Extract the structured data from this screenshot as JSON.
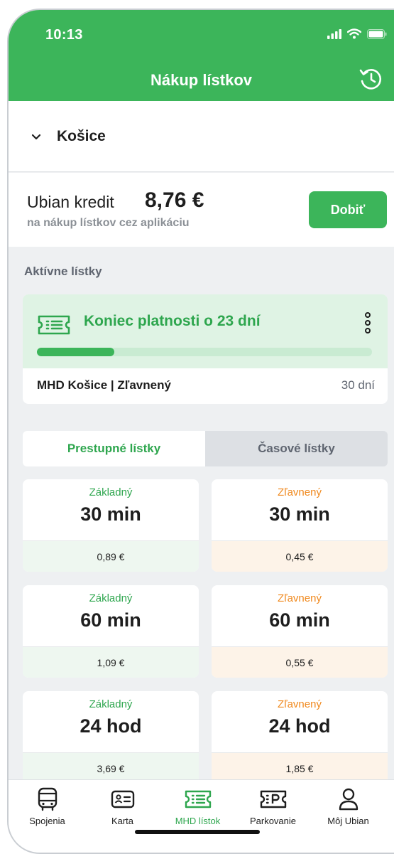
{
  "status": {
    "time": "10:13"
  },
  "header": {
    "title": "Nákup lístkov"
  },
  "city": {
    "name": "Košice"
  },
  "credit": {
    "label": "Ubian kredit",
    "amount": "8,76 €",
    "subtitle": "na nákup lístkov cez aplikáciu",
    "topup_label": "Dobiť"
  },
  "active": {
    "heading": "Aktívne lístky",
    "title": "Koniec platnosti o 23 dní",
    "progress_fraction": 0.23,
    "name": "MHD Košice | Zľavnený",
    "duration": "30 dní"
  },
  "tabs": [
    {
      "label": "Prestupné lístky",
      "selected": true
    },
    {
      "label": "Časové lístky",
      "selected": false
    }
  ],
  "tickets": [
    {
      "type": "Základný",
      "duration": "30 min",
      "price": "0,89 €"
    },
    {
      "type": "Zľavnený",
      "duration": "30 min",
      "price": "0,45 €"
    },
    {
      "type": "Základný",
      "duration": "60 min",
      "price": "1,09 €"
    },
    {
      "type": "Zľavnený",
      "duration": "60 min",
      "price": "0,55 €"
    },
    {
      "type": "Základný",
      "duration": "24 hod",
      "price": "3,69 €"
    },
    {
      "type": "Zľavnený",
      "duration": "24 hod",
      "price": "1,85 €"
    }
  ],
  "nav": [
    {
      "label": "Spojenia",
      "icon": "bus-icon"
    },
    {
      "label": "Karta",
      "icon": "id-card-icon"
    },
    {
      "label": "MHD lístok",
      "icon": "ticket-icon",
      "current": true
    },
    {
      "label": "Parkovanie",
      "icon": "parking-ticket-icon"
    },
    {
      "label": "Môj Ubian",
      "icon": "user-icon"
    }
  ],
  "colors": {
    "brand_green": "#3cb55a",
    "discount_orange": "#f0891e"
  }
}
